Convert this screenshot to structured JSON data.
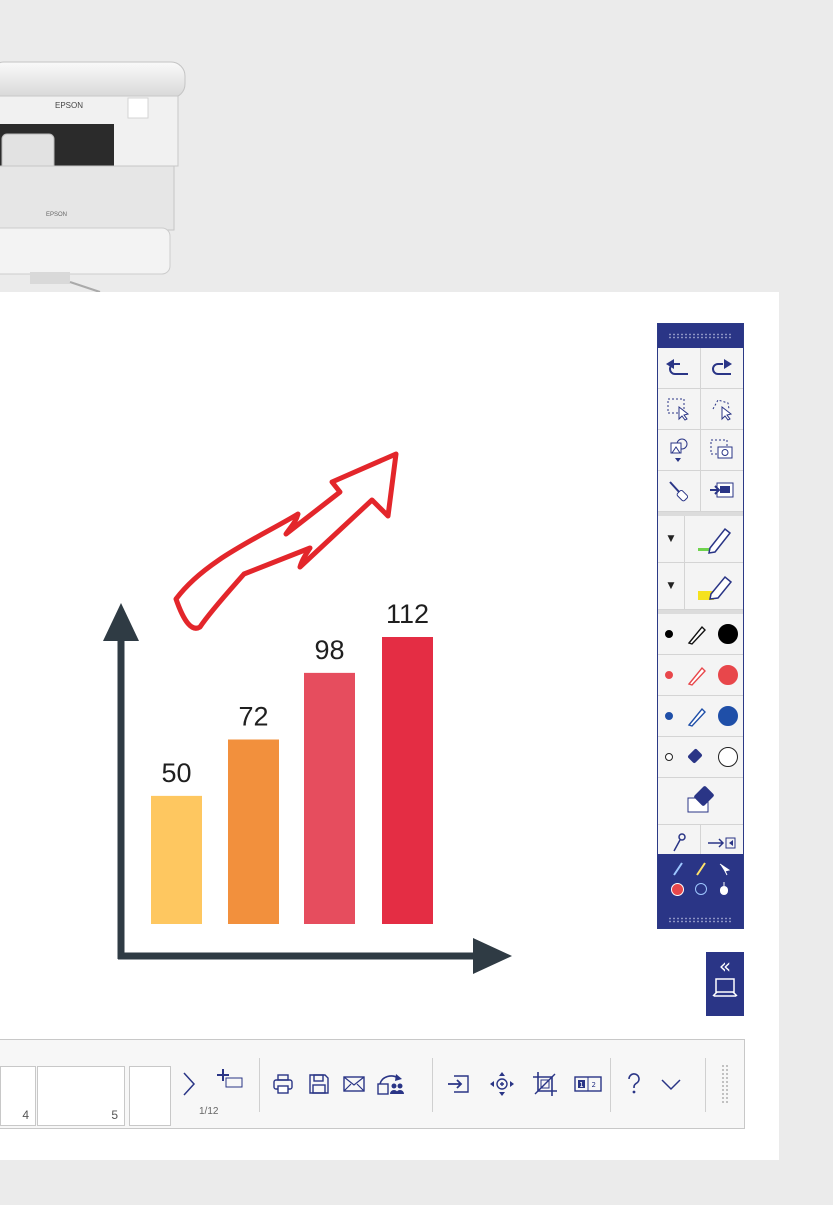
{
  "projector": {
    "brand_top": "EPSON",
    "brand_front": "EPSON"
  },
  "chart_data": {
    "type": "bar",
    "categories": [
      "",
      "",
      "",
      ""
    ],
    "values": [
      50,
      72,
      98,
      112
    ],
    "colors": [
      "#fec760",
      "#f2903d",
      "#e64d5e",
      "#e42d44"
    ],
    "ylim": [
      0,
      140
    ],
    "title": "",
    "xlabel": "",
    "ylabel": ""
  },
  "toolbar": {
    "tools": [
      "undo-icon",
      "redo-icon",
      "select-icon",
      "lasso-select-icon",
      "shapes-icon",
      "screenshot-icon",
      "marker-icon",
      "insert-image-icon",
      "pen-icon",
      "highlighter-icon",
      "eraser-icon",
      "stamp-icon",
      "exit-icon"
    ],
    "pen_colors": [
      "#000000",
      "#e8474b",
      "#1f4fa8",
      "#ffffff"
    ],
    "accent": "#2a3586"
  },
  "bottombar": {
    "thumbnails": [
      {
        "num": "4"
      },
      {
        "num": "5"
      },
      {
        "num": ""
      }
    ],
    "page_counter": "1/12",
    "buttons": [
      "next-icon",
      "add-page-icon",
      "print-icon",
      "save-icon",
      "email-icon",
      "share-icon",
      "import-icon",
      "zoom-icon",
      "crop-icon",
      "split-view-icon",
      "help-icon",
      "collapse-icon"
    ]
  }
}
